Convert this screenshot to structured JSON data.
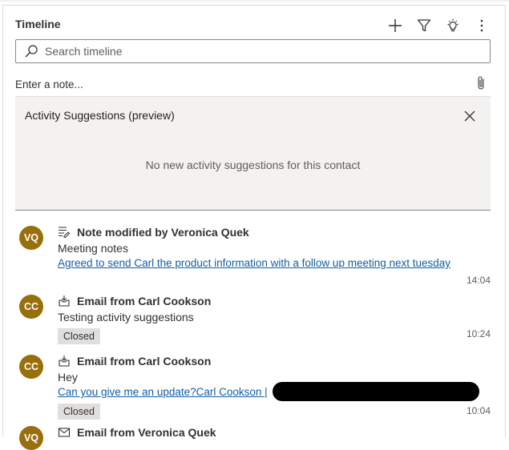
{
  "timeline": {
    "title": "Timeline",
    "icons": [
      "add-icon",
      "filter-icon",
      "lightbulb-icon",
      "more-icon"
    ],
    "search_placeholder": "Search timeline",
    "note_placeholder": "Enter a note..."
  },
  "suggestions": {
    "title": "Activity Suggestions (preview)",
    "empty_text": "No new activity suggestions for this contact"
  },
  "activities": [
    {
      "initials": "VQ",
      "icon": "note-icon",
      "title": "Note modified by Veronica Quek",
      "subtitle": "Meeting notes",
      "link": "Agreed to send Carl the product information with a follow up meeting next tuesday",
      "time": "14:04"
    },
    {
      "initials": "CC",
      "icon": "email-received-icon",
      "title": "Email from Carl Cookson",
      "subtitle": "Testing activity suggestions",
      "badge": "Closed",
      "time": "10:24"
    },
    {
      "initials": "CC",
      "icon": "email-received-icon",
      "title": "Email from Carl Cookson",
      "subtitle": "Hey",
      "link": "Can you give me an update?Carl Cookson |",
      "badge": "Closed",
      "time": "10:04"
    },
    {
      "initials": "VQ",
      "icon": "email-icon",
      "title": "Email from Veronica Quek"
    }
  ],
  "colors": {
    "avatar": "#986f0b",
    "link": "#115ea3",
    "panel_bg": "#f3f2f1"
  }
}
